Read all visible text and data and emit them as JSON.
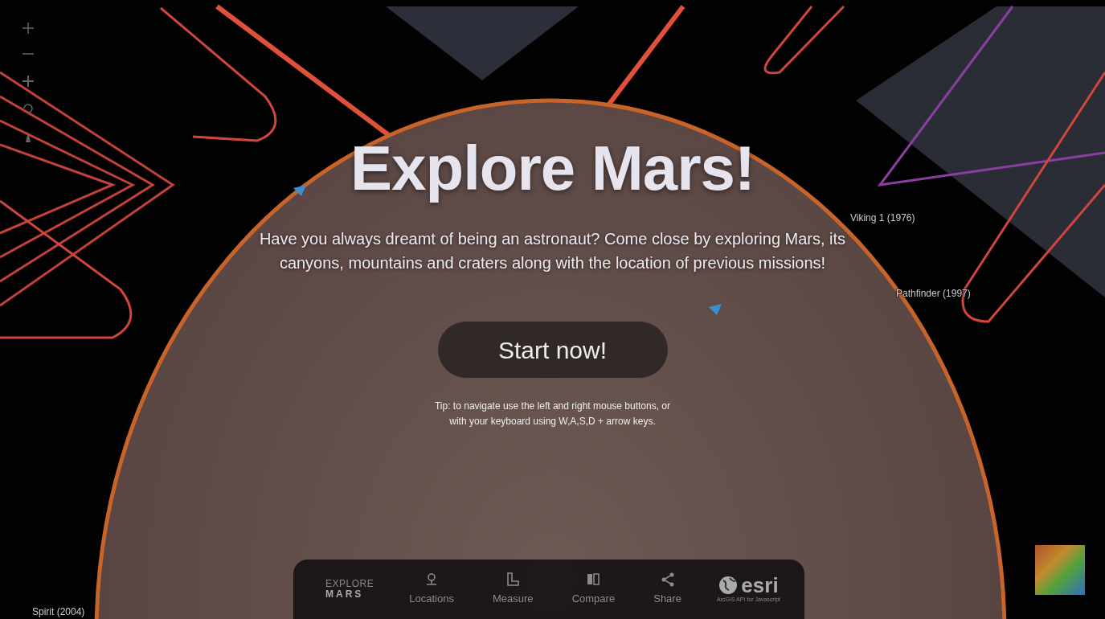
{
  "hero": {
    "title": "Explore Mars!",
    "subtitle": "Have you always dreamt of being an astronaut? Come close by exploring Mars, its canyons, mountains and craters along with the location of previous missions!",
    "button": "Start now!",
    "tip": "Tip: to navigate use the left and right mouse buttons, or with your keyboard using W,A,S,D + arrow keys."
  },
  "map_labels": [
    {
      "text": "Viking 1 (1976)"
    },
    {
      "text": "Pathfinder (1997)"
    },
    {
      "text": "Spirit (2004)"
    }
  ],
  "bottom_bar": {
    "logo": {
      "line_1": "EXPLORE",
      "line_2": "MARS"
    },
    "nav": [
      {
        "label": "Locations",
        "kind": "pin"
      },
      {
        "label": "Measure",
        "kind": "ruler"
      },
      {
        "label": "Compare",
        "kind": "compare"
      },
      {
        "label": "Share",
        "kind": "share"
      }
    ],
    "brand": {
      "name": "esri",
      "caption": "ArcGIS API for Javascript"
    }
  }
}
